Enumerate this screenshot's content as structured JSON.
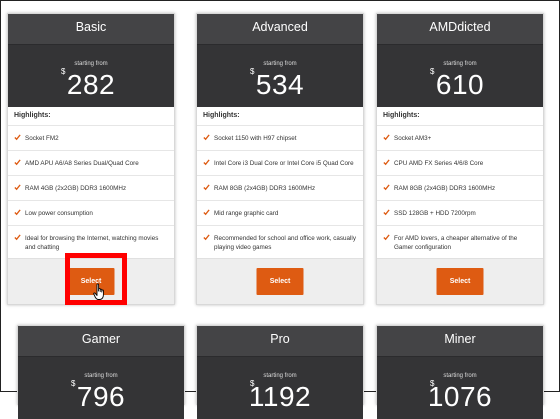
{
  "colors": {
    "accent": "#de5b12",
    "header": "#444446",
    "price_bg": "#343436",
    "highlight": "#ff0000"
  },
  "starting_from": "starting from",
  "currency": "$",
  "highlights_label": "Highlights:",
  "select_label": "Select",
  "plans": [
    {
      "name": "Basic",
      "price": "282",
      "features": [
        "Socket FM2",
        "AMD APU A6/A8 Series Dual/Quad Core",
        "RAM 4GB (2x2GB) DDR3 1600MHz",
        "Low power consumption",
        "Ideal for browsing the Internet, watching movies and chatting"
      ]
    },
    {
      "name": "Advanced",
      "price": "534",
      "features": [
        "Socket 1150 with H97 chipset",
        "Intel Core i3 Dual Core or Intel Core i5 Quad Core",
        "RAM 8GB (2x4GB) DDR3 1600MHz",
        "Mid range graphic card",
        "Recommended for school and office work, casually playing video games"
      ]
    },
    {
      "name": "AMDdicted",
      "price": "610",
      "features": [
        "Socket AM3+",
        "CPU AMD FX Series 4/6/8 Core",
        "RAM 8GB (2x4GB) DDR3 1600MHz",
        "SSD 128GB + HDD 7200rpm",
        "For AMD lovers, a cheaper alternative of the Gamer configuration"
      ]
    },
    {
      "name": "Gamer",
      "price": "796"
    },
    {
      "name": "Pro",
      "price": "1192"
    },
    {
      "name": "Miner",
      "price": "1076"
    }
  ]
}
